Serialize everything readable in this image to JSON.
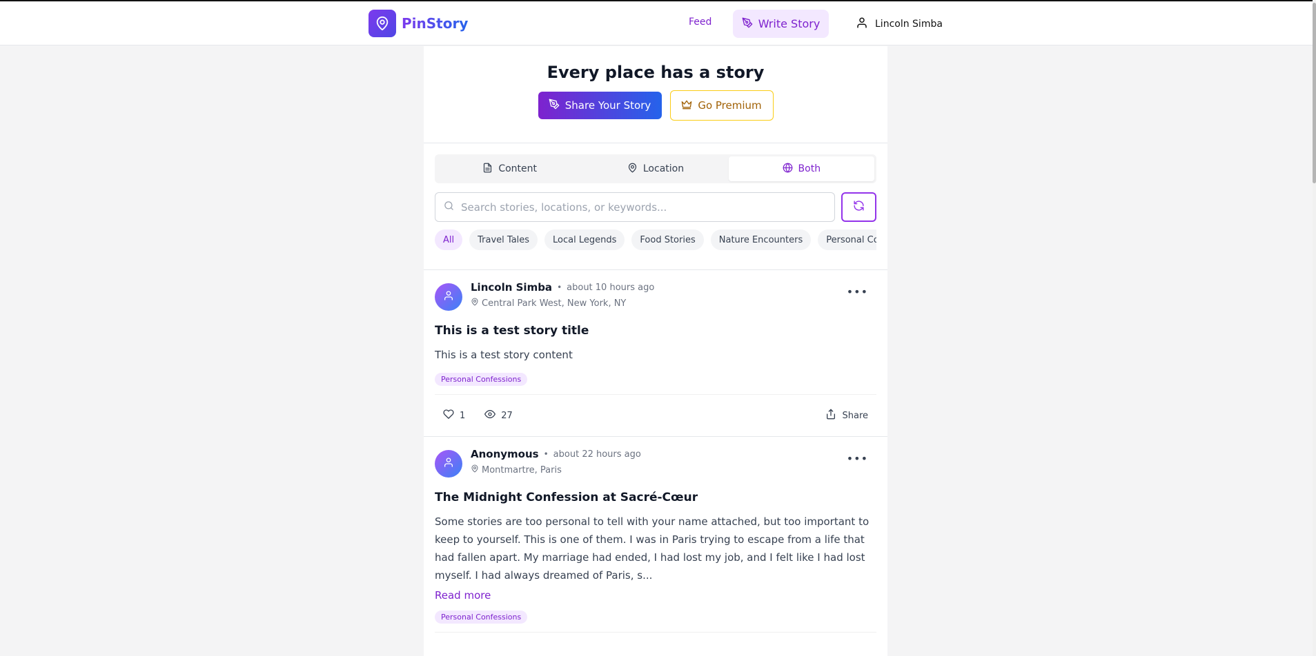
{
  "header": {
    "brand": "PinStory",
    "nav": {
      "feed": "Feed",
      "write_story": "Write Story",
      "user": "Lincoln Simba"
    }
  },
  "hero": {
    "title": "Every place has a story",
    "share_button": "Share Your Story",
    "premium_button": "Go Premium"
  },
  "search_mode": {
    "tabs": [
      {
        "label": "Content",
        "icon": "document-icon"
      },
      {
        "label": "Location",
        "icon": "map-pin-icon"
      },
      {
        "label": "Both",
        "icon": "globe-icon",
        "active": true
      }
    ]
  },
  "search": {
    "placeholder": "Search stories, locations, or keywords...",
    "value": ""
  },
  "categories": [
    "All",
    "Travel Tales",
    "Local Legends",
    "Food Stories",
    "Nature Encounters",
    "Personal Confessions"
  ],
  "stories": [
    {
      "author": "Lincoln Simba",
      "time": "about 10 hours ago",
      "location": "Central Park West, New York, NY",
      "title": "This is a test story title",
      "body": "This is a test story content",
      "tag": "Personal Confessions",
      "likes": "1",
      "views": "27",
      "share": "Share"
    },
    {
      "author": "Anonymous",
      "time": "about 22 hours ago",
      "location": "Montmartre, Paris",
      "title": "The Midnight Confession at Sacré-Cœur",
      "body": "Some stories are too personal to tell with your name attached, but too important to keep to yourself. This is one of them. I was in Paris trying to escape from a life that had fallen apart. My marriage had ended, I had lost my job, and I felt like I had lost myself. I had always dreamed of Paris, s...",
      "read_more": "Read more",
      "tag": "Personal Confessions"
    }
  ],
  "colors": {
    "accent": "#7e22ce",
    "accent_light": "#f3e8ff",
    "premium": "#facc15",
    "gradient_end": "#2563eb"
  }
}
